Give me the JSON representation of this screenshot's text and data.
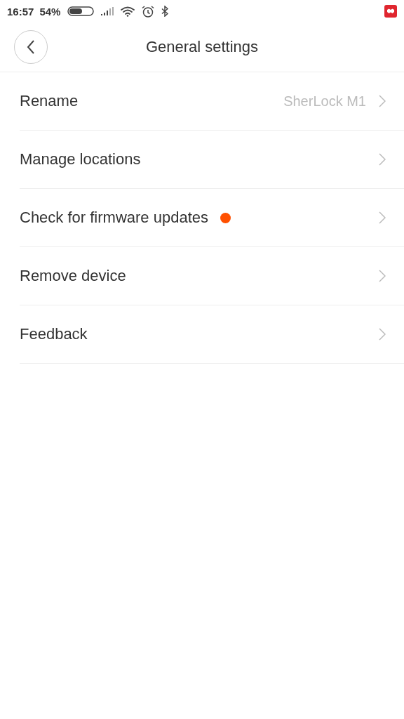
{
  "status_bar": {
    "time": "16:57",
    "battery": "54%"
  },
  "header": {
    "title": "General settings"
  },
  "items": [
    {
      "label": "Rename",
      "value": "SherLock M1",
      "notification": false
    },
    {
      "label": "Manage locations",
      "notification": false
    },
    {
      "label": "Check for firmware updates",
      "notification": true
    },
    {
      "label": "Remove device",
      "notification": false
    },
    {
      "label": "Feedback",
      "notification": false
    }
  ]
}
